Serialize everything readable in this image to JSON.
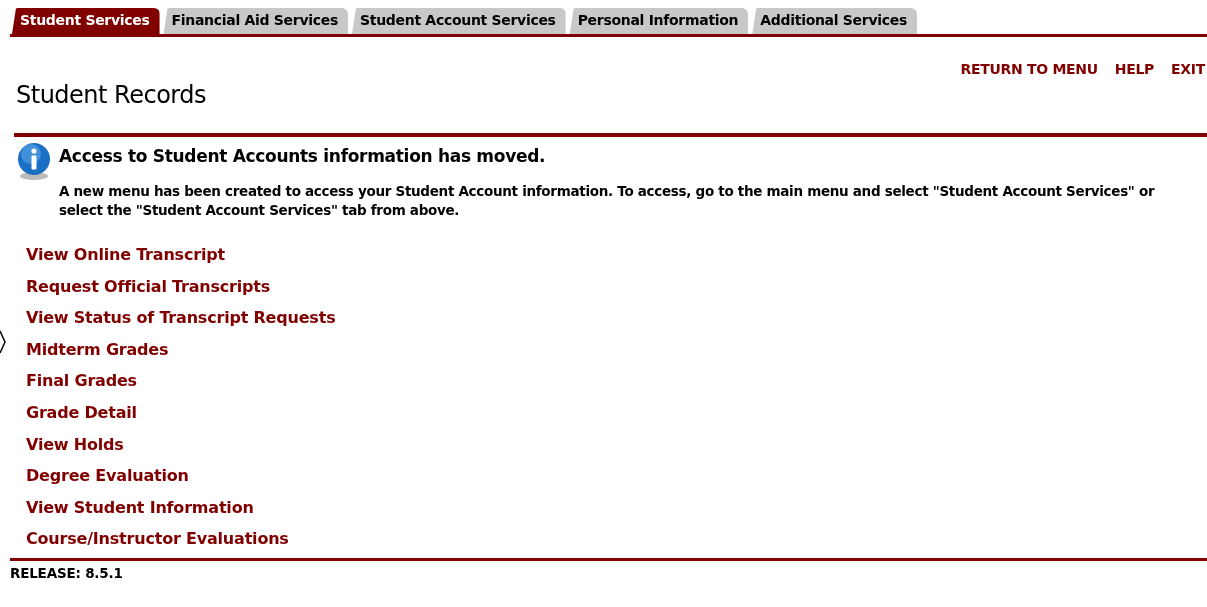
{
  "tabs": [
    {
      "label": "Student Services",
      "selected": true
    },
    {
      "label": "Financial Aid Services",
      "selected": false
    },
    {
      "label": "Student Account Services",
      "selected": false
    },
    {
      "label": "Personal Information",
      "selected": false
    },
    {
      "label": "Additional Services",
      "selected": false
    }
  ],
  "top_links": [
    "RETURN TO MENU",
    "HELP",
    "EXIT"
  ],
  "page_title": "Student Records",
  "info": {
    "heading": "Access to Student Accounts information has moved.",
    "message": "A new menu has been created to access your Student Account information. To access, go to the main menu and select \"Student Account Services\" or select the \"Student Account Services\" tab from above."
  },
  "menu_links": [
    "View Online Transcript",
    "Request Official Transcripts",
    "View Status of Transcript Requests",
    "Midterm Grades",
    "Final Grades",
    "Grade Detail",
    "View Holds",
    "Degree Evaluation",
    "View Student Information",
    "Course/Instructor Evaluations"
  ],
  "release": "RELEASE: 8.5.1"
}
